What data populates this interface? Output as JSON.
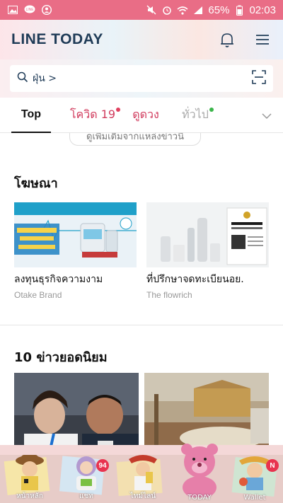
{
  "status_bar": {
    "battery": "65%",
    "time": "02:03"
  },
  "header": {
    "logo": "LINE TODAY"
  },
  "search": {
    "query": "ฝุ่น >"
  },
  "tabs": [
    {
      "label": "Top",
      "dot_color": ""
    },
    {
      "label": "โควิด 19",
      "dot_color": "#e0405f"
    },
    {
      "label": "ดูดวง",
      "dot_color": ""
    },
    {
      "label": "ทั่วไป",
      "dot_color": "#3ab54a"
    }
  ],
  "peek_card": {
    "text": "ดูเพิ่มเติมจากแหล่งข่าวนี้"
  },
  "ads": {
    "title": "โฆษณา",
    "items": [
      {
        "title": "ลงทุนธุรกิจความงาม",
        "source": "Otake Brand"
      },
      {
        "title": "ที่ปรึกษาจดทะเบียนอย.",
        "source": "The flowrich"
      }
    ]
  },
  "top_news": {
    "title": "10 ข่าวยอดนิยม"
  },
  "bottom_nav": [
    {
      "label": "หน้าหลัก",
      "badge": ""
    },
    {
      "label": "แชท",
      "badge": "94"
    },
    {
      "label": "ไทม์ไลน์",
      "badge": ""
    },
    {
      "label": "TODAY",
      "badge": ""
    },
    {
      "label": "Wallet",
      "badge": "N"
    }
  ],
  "colors": {
    "accent_pink": "#d13c5e",
    "status_bar": "#e96d86",
    "badge_red": "#e8334f"
  }
}
